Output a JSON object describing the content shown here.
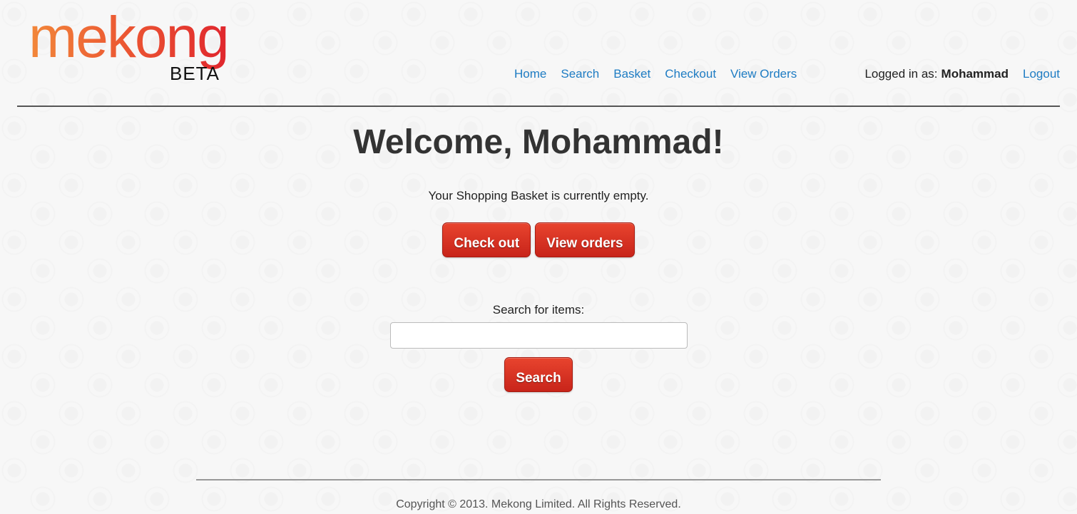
{
  "logo": {
    "word": "mekong",
    "tag": "BETA"
  },
  "nav": {
    "items": [
      {
        "label": "Home"
      },
      {
        "label": "Search"
      },
      {
        "label": "Basket"
      },
      {
        "label": "Checkout"
      },
      {
        "label": "View Orders"
      }
    ]
  },
  "user": {
    "logged_in_label": "Logged in as:",
    "username": "Mohammad",
    "logout_label": "Logout"
  },
  "main": {
    "welcome": "Welcome, Mohammad!",
    "basket_message": "Your Shopping Basket is currently empty.",
    "checkout_button": "Check out",
    "view_orders_button": "View orders",
    "search_label": "Search for items:",
    "search_value": "",
    "search_button": "Search"
  },
  "footer": {
    "copyright": "Copyright © 2013. Mekong Limited. All Rights Reserved."
  },
  "colors": {
    "link": "#1e7cc3",
    "button": "#d3301f",
    "logo_start": "#f2883a",
    "logo_end": "#e0262d"
  }
}
